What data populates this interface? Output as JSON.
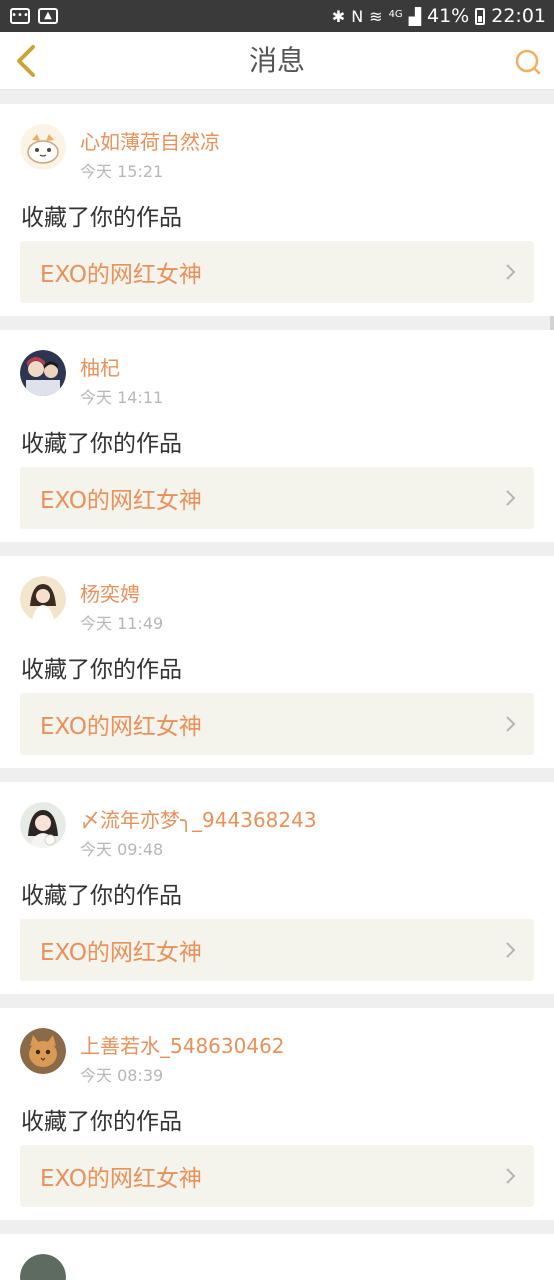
{
  "status_bar": {
    "battery": "41%",
    "network": "4G",
    "time": "22:01"
  },
  "header": {
    "title": "消息"
  },
  "colors": {
    "accent": "#e8915a",
    "back_icon": "#c9a534",
    "search_icon": "#f0b060"
  },
  "messages": [
    {
      "user": "心如薄荷自然凉",
      "time": "今天 15:21",
      "action": "收藏了你的作品",
      "work": "EXO的网红女神",
      "avatar": "cartoon-bird-avatar"
    },
    {
      "user": "柚杞",
      "time": "今天 14:11",
      "action": "收藏了你的作品",
      "work": "EXO的网红女神",
      "avatar": "couple-photo-avatar"
    },
    {
      "user": "杨奕娉",
      "time": "今天 11:49",
      "action": "收藏了你的作品",
      "work": "EXO的网红女神",
      "avatar": "girl-photo-avatar"
    },
    {
      "user": "〆流年亦梦╮_944368243",
      "time": "今天 09:48",
      "action": "收藏了你的作品",
      "work": "EXO的网红女神",
      "avatar": "girl-selfie-avatar"
    },
    {
      "user": "上善若水_548630462",
      "time": "今天 08:39",
      "action": "收藏了你的作品",
      "work": "EXO的网红女神",
      "avatar": "cat-photo-avatar"
    }
  ]
}
